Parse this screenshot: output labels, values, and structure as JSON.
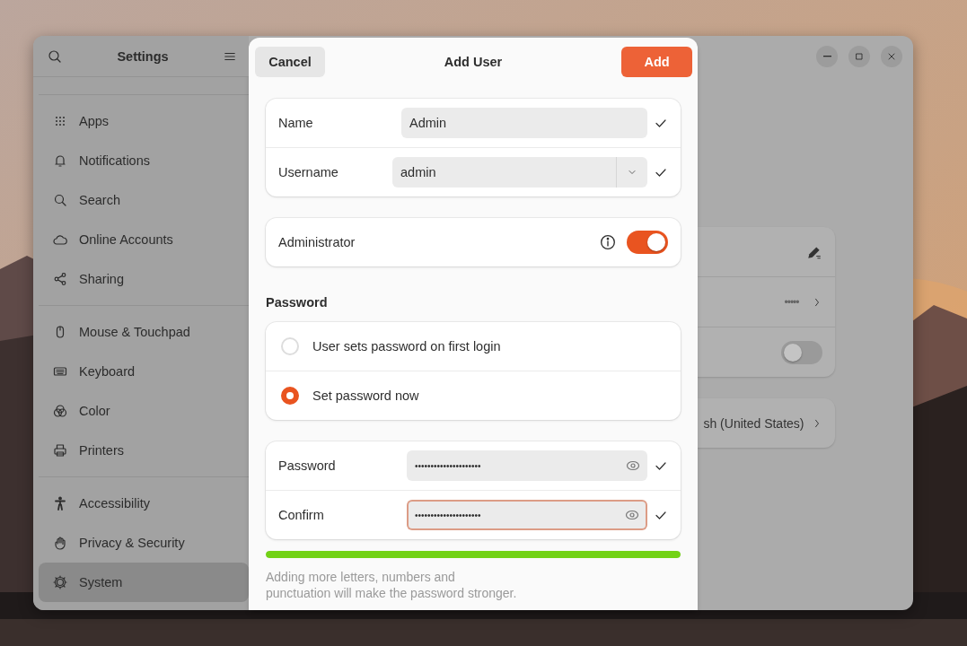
{
  "settings": {
    "title": "Settings",
    "sidebar": {
      "groups": [
        {
          "items": [
            {
              "label": "Apps",
              "selected": false
            },
            {
              "label": "Notifications",
              "selected": false
            },
            {
              "label": "Search",
              "selected": false
            },
            {
              "label": "Online Accounts",
              "selected": false
            },
            {
              "label": "Sharing",
              "selected": false
            }
          ]
        },
        {
          "items": [
            {
              "label": "Mouse & Touchpad",
              "selected": false
            },
            {
              "label": "Keyboard",
              "selected": false
            },
            {
              "label": "Color",
              "selected": false
            },
            {
              "label": "Printers",
              "selected": false
            }
          ]
        },
        {
          "items": [
            {
              "label": "Accessibility",
              "selected": false
            },
            {
              "label": "Privacy & Security",
              "selected": false
            },
            {
              "label": "System",
              "selected": true
            }
          ]
        }
      ]
    },
    "account_rows": [
      {
        "kind": "edit"
      },
      {
        "kind": "value",
        "value": "•••••"
      },
      {
        "kind": "toggle",
        "on": false
      }
    ],
    "language_row": {
      "value": "sh (United States)"
    }
  },
  "dialog": {
    "title": "Add User",
    "cancel": "Cancel",
    "confirm": "Add",
    "identity": [
      {
        "kind": "entry",
        "label": "Name",
        "value": "Admin",
        "valid": true
      },
      {
        "kind": "combo",
        "label": "Username",
        "value": "admin",
        "valid": true
      }
    ],
    "administrator": {
      "label": "Administrator",
      "on": true
    },
    "password_heading": "Password",
    "password_modes": [
      {
        "label": "User sets password on first login",
        "selected": false
      },
      {
        "label": "Set password now",
        "selected": true
      }
    ],
    "password_fields": [
      {
        "label": "Password",
        "value": "•••••••••••••••••••••",
        "focused": false,
        "valid": true
      },
      {
        "label": "Confirm",
        "value": "•••••••••••••••••••••",
        "focused": true,
        "valid": true
      }
    ],
    "strength": {
      "level": 1
    },
    "hint": "Adding more letters, numbers and\npunctuation will make the password stronger."
  }
}
